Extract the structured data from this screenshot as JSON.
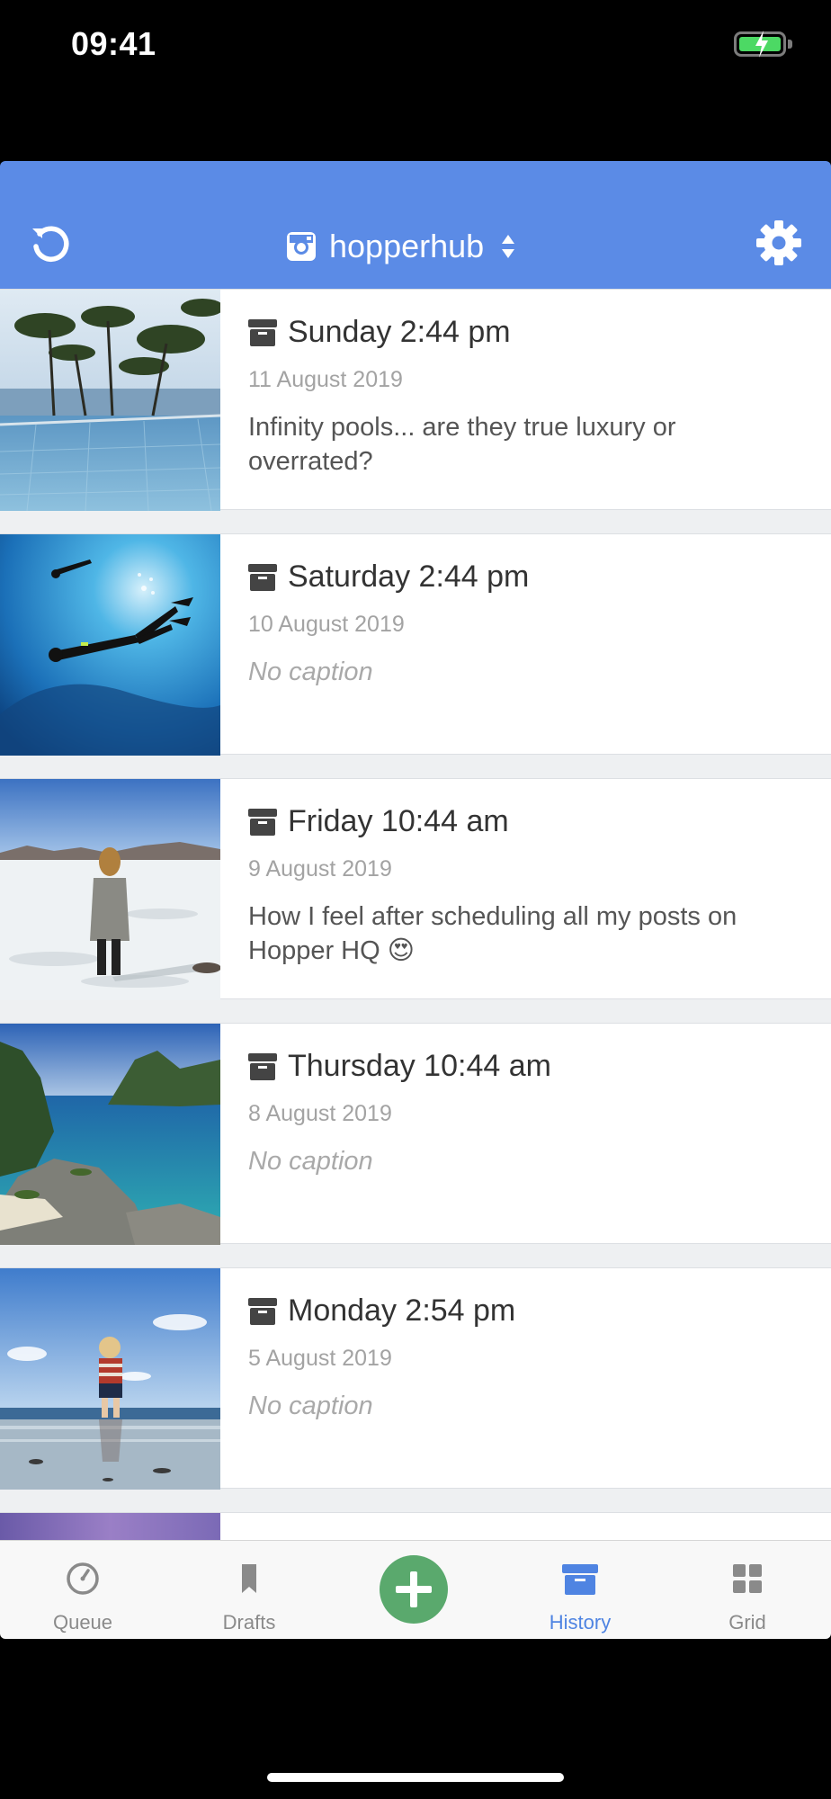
{
  "status_bar": {
    "time": "09:41",
    "battery_icon": "battery-charging-icon"
  },
  "header": {
    "account_name": "hopperhub",
    "account_icon": "instagram-icon",
    "refresh_icon": "refresh-icon",
    "settings_icon": "gear-icon",
    "background": "#5b8be6"
  },
  "posts": [
    {
      "day_time": "Sunday 2:44 pm",
      "date": "11 August 2019",
      "caption": "Infinity pools... are they true luxury or overrated?",
      "has_caption": true,
      "image": "infinity-pool-photo"
    },
    {
      "day_time": "Saturday 2:44 pm",
      "date": "10 August 2019",
      "caption": "No caption",
      "has_caption": false,
      "image": "scuba-diver-photo"
    },
    {
      "day_time": "Friday 10:44 am",
      "date": "9 August 2019",
      "caption": "How I feel after scheduling all my posts on Hopper HQ 😍",
      "has_caption": true,
      "image": "woman-salt-flat-photo"
    },
    {
      "day_time": "Thursday 10:44 am",
      "date": "8 August 2019",
      "caption": "No caption",
      "has_caption": false,
      "image": "tropical-lagoon-photo"
    },
    {
      "day_time": "Monday 2:54 pm",
      "date": "5 August 2019",
      "caption": "No caption",
      "has_caption": false,
      "image": "child-beach-photo"
    }
  ],
  "tabs": [
    {
      "label": "Queue",
      "icon": "clock-icon"
    },
    {
      "label": "Drafts",
      "icon": "bookmark-icon"
    },
    {
      "label": "",
      "icon": "plus-icon"
    },
    {
      "label": "History",
      "icon": "archive-icon",
      "active": true
    },
    {
      "label": "Grid",
      "icon": "grid-icon"
    }
  ],
  "colors": {
    "accent": "#5b8be6",
    "active_tab": "#4f84e2",
    "compose": "#5aa96d"
  }
}
